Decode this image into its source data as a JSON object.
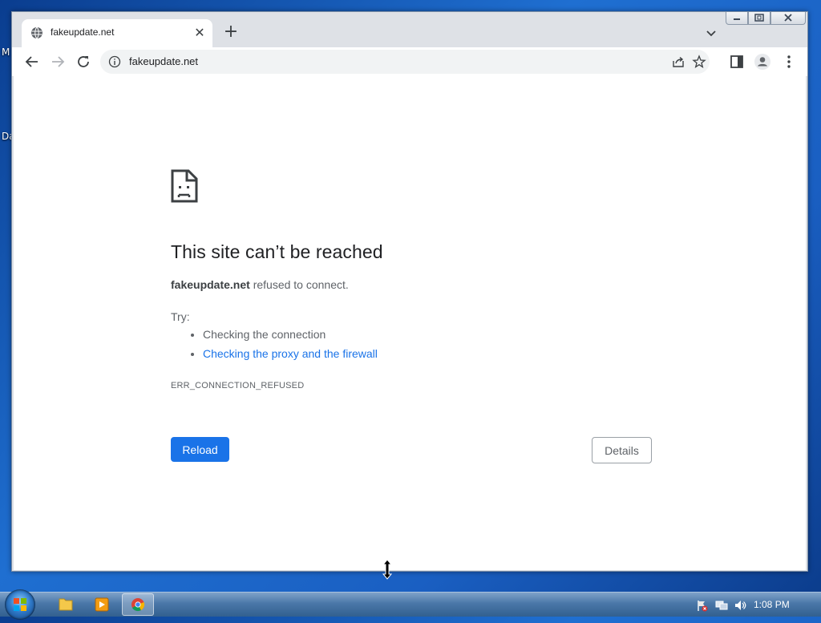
{
  "desktop": {
    "label_1": "M",
    "label_2": "Da"
  },
  "browser": {
    "tab": {
      "title": "fakeupdate.net",
      "close_glyph": "✕"
    },
    "new_tab_glyph": "+",
    "address": {
      "url": "fakeupdate.net"
    }
  },
  "error_page": {
    "title": "This site can’t be reached",
    "host": "fakeupdate.net",
    "description_rest": " refused to connect.",
    "try_label": "Try:",
    "suggestions": [
      "Checking the connection",
      "Checking the proxy and the firewall"
    ],
    "error_code": "ERR_CONNECTION_REFUSED",
    "reload_label": "Reload",
    "details_label": "Details"
  },
  "taskbar": {
    "clock": "1:08 PM"
  },
  "colors": {
    "accent": "#1a73e8",
    "text_primary": "#202124",
    "text_secondary": "#5f6368"
  }
}
